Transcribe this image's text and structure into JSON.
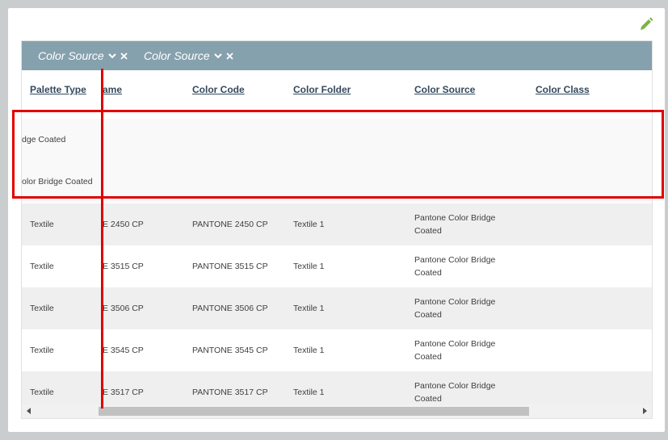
{
  "group_chips": [
    {
      "label": "Color Source"
    },
    {
      "label": "Color Source"
    }
  ],
  "columns": [
    "Palette Type",
    "ame",
    "Color Code",
    "Color Folder",
    "Color Source",
    "Color Class"
  ],
  "ghost_rows": [
    {
      "partial_text": "dge Coated"
    },
    {
      "partial_text": "olor Bridge Coated"
    }
  ],
  "rows": [
    {
      "palette_type": "Textile",
      "name": "E 2450 CP",
      "color_code": "PANTONE 2450 CP",
      "color_folder": "Textile 1",
      "color_source": "Pantone Color Bridge Coated",
      "color_class": ""
    },
    {
      "palette_type": "Textile",
      "name": "E 3515 CP",
      "color_code": "PANTONE 3515 CP",
      "color_folder": "Textile 1",
      "color_source": "Pantone Color Bridge Coated",
      "color_class": ""
    },
    {
      "palette_type": "Textile",
      "name": "E 3506 CP",
      "color_code": "PANTONE 3506 CP",
      "color_folder": "Textile 1",
      "color_source": "Pantone Color Bridge Coated",
      "color_class": ""
    },
    {
      "palette_type": "Textile",
      "name": "E 3545 CP",
      "color_code": "PANTONE 3545 CP",
      "color_folder": "Textile 1",
      "color_source": "Pantone Color Bridge Coated",
      "color_class": ""
    },
    {
      "palette_type": "Textile",
      "name": "E 3517 CP",
      "color_code": "PANTONE 3517 CP",
      "color_folder": "Textile 1",
      "color_source": "Pantone Color Bridge Coated",
      "color_class": ""
    }
  ],
  "icons": {
    "edit": "pencil-icon",
    "chip_dropdown": "chevron-down-icon",
    "chip_remove": "close-icon"
  },
  "colors": {
    "group_bar": "#86a1ae",
    "header_text": "#34495e",
    "alt_row": "#efefef",
    "highlight": "#e00000",
    "edit_icon": "#7cb342"
  }
}
